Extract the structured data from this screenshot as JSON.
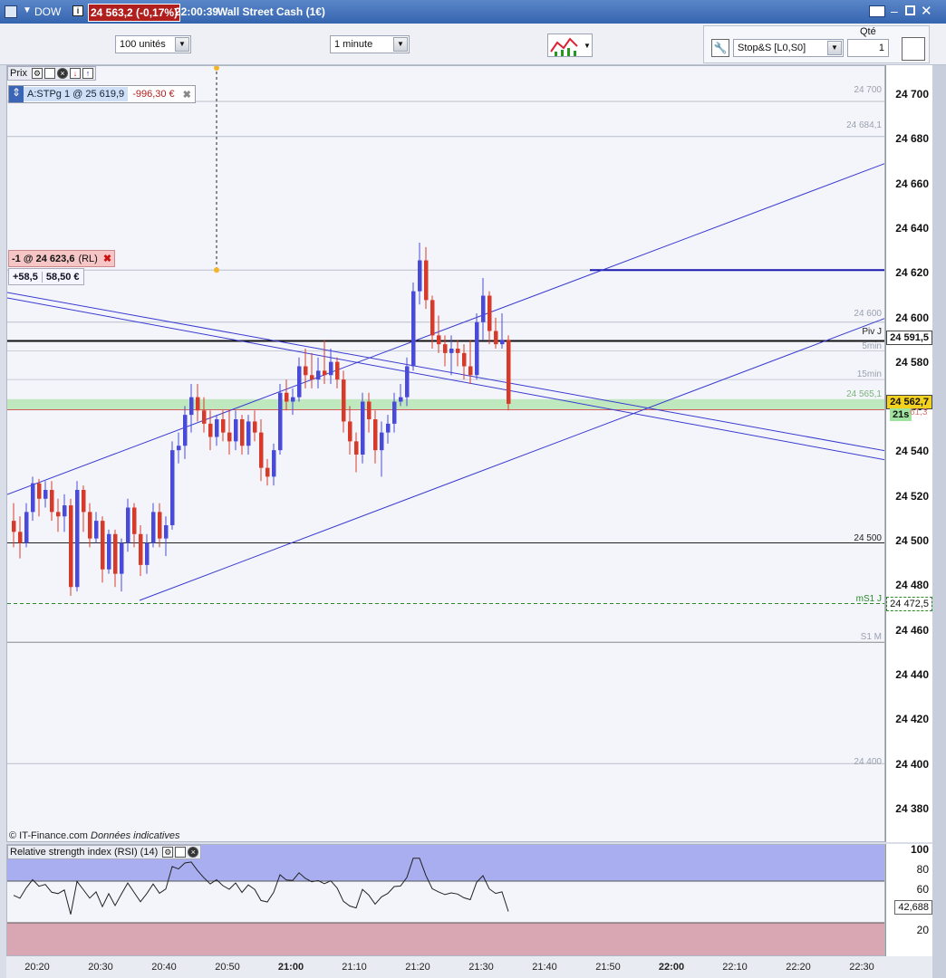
{
  "window": {
    "symbol": "DOW",
    "price_badge": "24 563,2 (-0,17%)",
    "time": "22:00:39",
    "instrument": "Wall Street Cash (1€)"
  },
  "toolbar": {
    "quantity_select": "100 unités",
    "timeframe_select": "1 minute",
    "order_type_select": "Stop&S [L0,S0]",
    "qty_label": "Qté",
    "qty_value": "1"
  },
  "panel": {
    "price_label": "Prix",
    "position_label": "A:STPg  1 @ 25 619,9",
    "position_pnl": "-996,30 €",
    "order_label": "-1 @ 24 623,6",
    "order_suffix": "(RL)",
    "order_points": "+58,5",
    "order_value": "58,50 €",
    "copyright": "© IT-Finance.com",
    "data_note": "Données indicatives"
  },
  "y_axis": {
    "labels": [
      "24 700",
      "24 680",
      "24 660",
      "24 640",
      "24 620",
      "24 600",
      "24 580",
      "24 560",
      "24 540",
      "24 520",
      "24 500",
      "24 480",
      "24 460",
      "24 440",
      "24 420",
      "24 400",
      "24 380"
    ]
  },
  "levels": {
    "l_24700": "24 700",
    "l_24684": "24 684,1",
    "l_24600": "24 600",
    "piv": "Piv J",
    "piv_value": "24 591,5",
    "m5": "5min",
    "m15": "15min",
    "l_24565": "24 565,1",
    "current": "24 562,7",
    "timer": "21s",
    "l_6133": "61,3",
    "l_24500": "24 500",
    "ms1": "mS1 J",
    "ms1_value": "24 472,5",
    "s1m": "S1 M",
    "l_24400": "24 400"
  },
  "rsi": {
    "title": "Relative strength index (RSI) (14)",
    "labels": [
      "100",
      "80",
      "60",
      "20"
    ],
    "value": "42,688"
  },
  "x_axis": {
    "labels": [
      "20:20",
      "20:30",
      "20:40",
      "20:50",
      "21:00",
      "21:10",
      "21:20",
      "21:30",
      "21:40",
      "21:50",
      "22:00",
      "22:10",
      "22:20",
      "22:30"
    ]
  },
  "colors": {
    "bull": "#4a4ad8",
    "bear": "#d83a2a",
    "channel": "#3a3ad0",
    "zone": "#a8e0a8"
  },
  "chart_data": {
    "type": "candlestick",
    "ylim": [
      24364,
      24716
    ],
    "candles_ohlc": [
      [
        24510,
        24518,
        24498,
        24505
      ],
      [
        24505,
        24512,
        24493,
        24500
      ],
      [
        24500,
        24518,
        24498,
        24514
      ],
      [
        24514,
        24530,
        24510,
        24527
      ],
      [
        24527,
        24529,
        24512,
        24520
      ],
      [
        24520,
        24528,
        24516,
        24524
      ],
      [
        24524,
        24528,
        24510,
        24514
      ],
      [
        24514,
        24520,
        24505,
        24512
      ],
      [
        24512,
        24522,
        24505,
        24517
      ],
      [
        24517,
        24520,
        24476,
        24480
      ],
      [
        24480,
        24528,
        24478,
        24524
      ],
      [
        24524,
        24526,
        24505,
        24514
      ],
      [
        24514,
        24518,
        24498,
        24502
      ],
      [
        24502,
        24514,
        24500,
        24510
      ],
      [
        24510,
        24512,
        24482,
        24488
      ],
      [
        24488,
        24506,
        24486,
        24504
      ],
      [
        24504,
        24506,
        24480,
        24486
      ],
      [
        24486,
        24502,
        24478,
        24500
      ],
      [
        24500,
        24520,
        24496,
        24516
      ],
      [
        24516,
        24518,
        24498,
        24504
      ],
      [
        24504,
        24508,
        24485,
        24490
      ],
      [
        24490,
        24504,
        24486,
        24500
      ],
      [
        24500,
        24518,
        24498,
        24514
      ],
      [
        24514,
        24518,
        24498,
        24502
      ],
      [
        24502,
        24512,
        24494,
        24508
      ],
      [
        24508,
        24546,
        24506,
        24542
      ],
      [
        24542,
        24550,
        24536,
        24544
      ],
      [
        24544,
        24562,
        24538,
        24558
      ],
      [
        24558,
        24572,
        24550,
        24566
      ],
      [
        24566,
        24572,
        24555,
        24560
      ],
      [
        24560,
        24566,
        24550,
        24554
      ],
      [
        24554,
        24560,
        24542,
        24548
      ],
      [
        24548,
        24558,
        24544,
        24556
      ],
      [
        24556,
        24560,
        24546,
        24550
      ],
      [
        24550,
        24560,
        24540,
        24546
      ],
      [
        24546,
        24560,
        24542,
        24556
      ],
      [
        24556,
        24558,
        24540,
        24544
      ],
      [
        24544,
        24558,
        24540,
        24555
      ],
      [
        24555,
        24560,
        24546,
        24550
      ],
      [
        24550,
        24556,
        24528,
        24534
      ],
      [
        24534,
        24538,
        24526,
        24530
      ],
      [
        24530,
        24545,
        24526,
        24542
      ],
      [
        24542,
        24572,
        24540,
        24568
      ],
      [
        24568,
        24574,
        24560,
        24564
      ],
      [
        24564,
        24570,
        24558,
        24566
      ],
      [
        24566,
        24584,
        24564,
        24580
      ],
      [
        24580,
        24588,
        24570,
        24576
      ],
      [
        24576,
        24586,
        24570,
        24574
      ],
      [
        24574,
        24584,
        24570,
        24578
      ],
      [
        24578,
        24592,
        24572,
        24576
      ],
      [
        24576,
        24588,
        24572,
        24582
      ],
      [
        24582,
        24584,
        24570,
        24574
      ],
      [
        24574,
        24578,
        24550,
        24555
      ],
      [
        24555,
        24562,
        24540,
        24546
      ],
      [
        24546,
        24550,
        24532,
        24540
      ],
      [
        24540,
        24568,
        24536,
        24564
      ],
      [
        24564,
        24568,
        24550,
        24556
      ],
      [
        24556,
        24560,
        24536,
        24542
      ],
      [
        24542,
        24555,
        24530,
        24550
      ],
      [
        24550,
        24558,
        24545,
        24554
      ],
      [
        24554,
        24568,
        24550,
        24564
      ],
      [
        24564,
        24572,
        24562,
        24566
      ],
      [
        24566,
        24584,
        24562,
        24580
      ],
      [
        24580,
        24618,
        24578,
        24614
      ],
      [
        24614,
        24636,
        24608,
        24628
      ],
      [
        24628,
        24634,
        24606,
        24610
      ],
      [
        24610,
        24612,
        24588,
        24594
      ],
      [
        24594,
        24603,
        24586,
        24590
      ],
      [
        24590,
        24594,
        24580,
        24586
      ],
      [
        24586,
        24594,
        24576,
        24588
      ],
      [
        24588,
        24592,
        24580,
        24586
      ],
      [
        24586,
        24590,
        24574,
        24580
      ],
      [
        24580,
        24592,
        24572,
        24576
      ],
      [
        24576,
        24604,
        24574,
        24600
      ],
      [
        24600,
        24620,
        24592,
        24612
      ],
      [
        24612,
        24614,
        24590,
        24596
      ],
      [
        24596,
        24602,
        24588,
        24590
      ],
      [
        24590,
        24604,
        24588,
        24592
      ],
      [
        24592,
        24594,
        24560,
        24563
      ]
    ]
  }
}
